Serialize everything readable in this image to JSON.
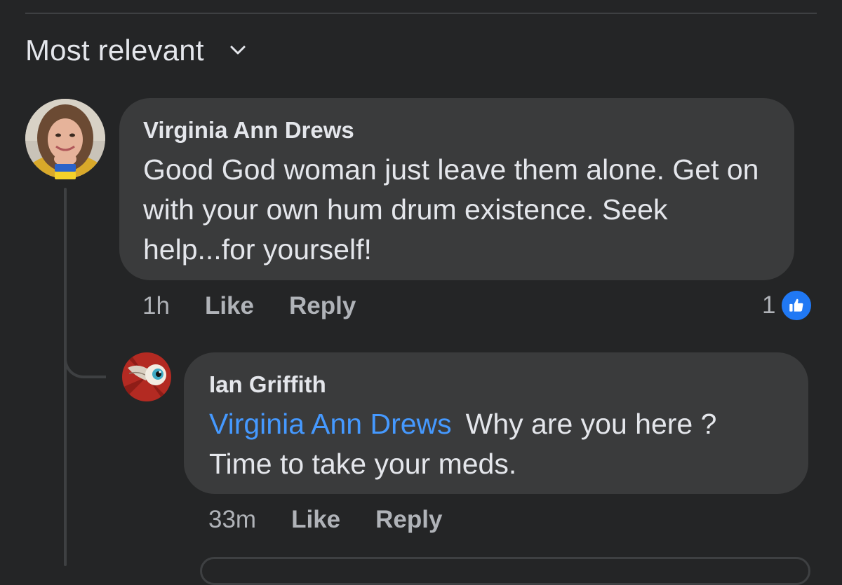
{
  "sort": {
    "label": "Most relevant",
    "chevron_icon": "chevron-down-icon"
  },
  "comments": [
    {
      "author": "Virginia Ann Drews",
      "text": "Good God woman just leave them alone. Get on with your own hum drum existence. Seek help...for yourself!",
      "time": "1h",
      "like_label": "Like",
      "reply_label": "Reply",
      "reaction_count": "1",
      "reaction_icon": "thumbs-up-icon",
      "avatar_icon": "profile-photo-avatar",
      "avatar_badge": "ukraine-flag-icon"
    }
  ],
  "replies": [
    {
      "author": "Ian Griffith",
      "mention": "Virginia Ann Drews",
      "text": "Why are you here ? Time to take your meds.",
      "time": "33m",
      "like_label": "Like",
      "reply_label": "Reply",
      "avatar_icon": "winged-eyeball-avatar"
    }
  ],
  "colors": {
    "background": "#242526",
    "bubble": "#3a3b3c",
    "text_primary": "#e4e6eb",
    "text_secondary": "#b0b3b8",
    "mention": "#4599ff",
    "like_blue": "#2078f4"
  }
}
